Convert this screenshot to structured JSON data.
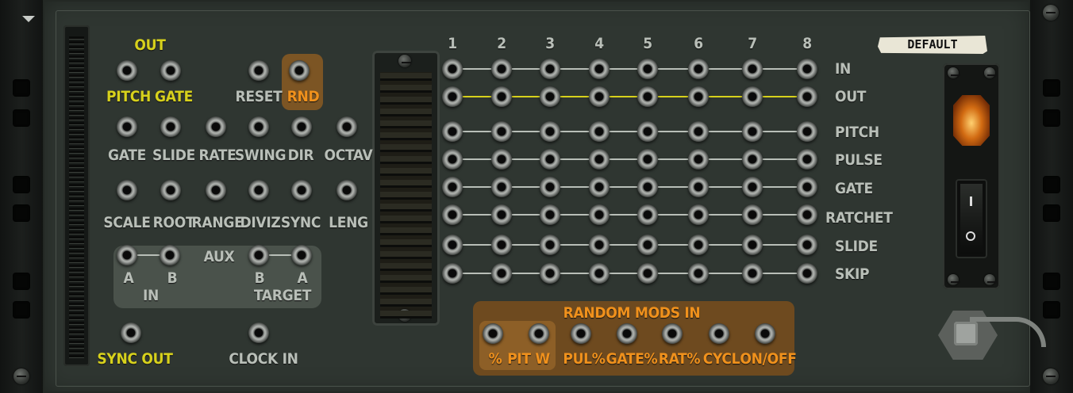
{
  "preset": {
    "name": "DEFAULT"
  },
  "out_section": {
    "title": "OUT",
    "pitch": "PITCH",
    "gate": "GATE",
    "reset": "RESET",
    "rnd": "RND"
  },
  "cv_inputs_row1": [
    "GATE",
    "SLIDE",
    "RATE",
    "SWING",
    "DIR",
    "OCTAV"
  ],
  "cv_inputs_row2": [
    "SCALE",
    "ROOT",
    "RANGE",
    "DIVIZ",
    "SYNC",
    "LENG"
  ],
  "aux": {
    "title": "AUX",
    "in_a": "A",
    "in_b": "B",
    "in_label": "IN",
    "target_b": "B",
    "target_a": "A",
    "target_label": "TARGET"
  },
  "sync_out": "SYNC OUT",
  "clock_in": "CLOCK IN",
  "matrix": {
    "columns": [
      "1",
      "2",
      "3",
      "4",
      "5",
      "6",
      "7",
      "8"
    ],
    "rows": [
      "IN",
      "OUT",
      "PITCH",
      "PULSE",
      "GATE",
      "RATCHET",
      "SLIDE",
      "SKIP"
    ]
  },
  "random_mods": {
    "title": "RANDOM MODS IN",
    "labels": [
      "%",
      "PIT W",
      "PUL%",
      "GATE%",
      "RAT%",
      "CYCL",
      "ON/OFF"
    ]
  },
  "colors": {
    "panel": "#2f3631",
    "label": "#b9bfb8",
    "yellow": "#d7d11c",
    "orange": "#f0911c"
  },
  "power_switch": {
    "on_symbol": "I",
    "off_symbol": "O"
  }
}
